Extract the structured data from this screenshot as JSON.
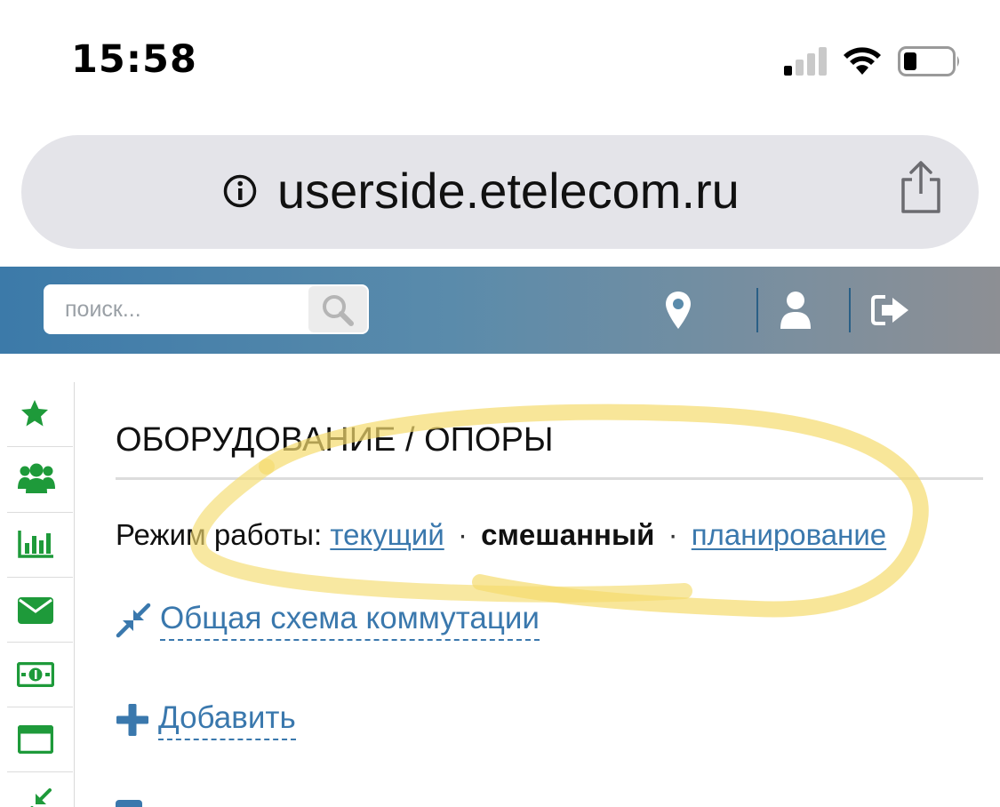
{
  "status_bar": {
    "time": "15:58"
  },
  "browser": {
    "url": "userside.etelecom.ru"
  },
  "header": {
    "search_placeholder": "поиск..."
  },
  "page": {
    "title": "ОБОРУДОВАНИЕ / ОПОРЫ",
    "mode": {
      "label": "Режим работы:",
      "current": "текущий",
      "mixed": "смешанный",
      "planning": "планирование",
      "separator": "·"
    },
    "actions": {
      "scheme": "Общая схема коммутации",
      "add": "Добавить"
    }
  },
  "colors": {
    "accent": "#3a78ad",
    "sidebar_icon": "#1e9a3a",
    "header_start": "#3c7aa9",
    "header_end": "#8d8f94",
    "highlight": "#f5dc6e"
  }
}
